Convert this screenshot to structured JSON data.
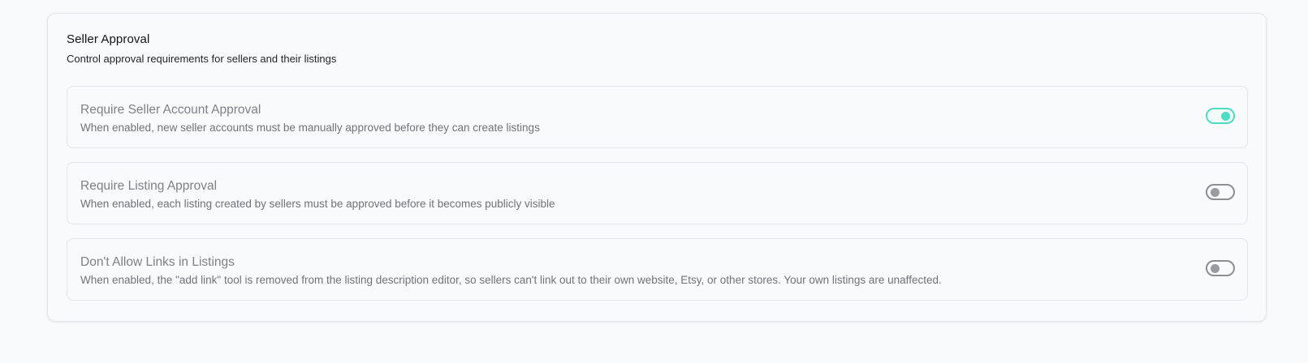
{
  "section": {
    "title": "Seller Approval",
    "subtitle": "Control approval requirements for sellers and their listings"
  },
  "settings": [
    {
      "title": "Require Seller Account Approval",
      "description": "When enabled, new seller accounts must be manually approved before they can create listings",
      "enabled": true
    },
    {
      "title": "Require Listing Approval",
      "description": "When enabled, each listing created by sellers must be approved before it becomes publicly visible",
      "enabled": false
    },
    {
      "title": "Don't Allow Links in Listings",
      "description": "When enabled, the \"add link\" tool is removed from the listing description editor, so sellers can't link out to their own website, Etsy, or other stores. Your own listings are unaffected.",
      "enabled": false
    }
  ],
  "colors": {
    "toggle_on": "#4fdcc4",
    "toggle_off": "#8b8e93"
  }
}
